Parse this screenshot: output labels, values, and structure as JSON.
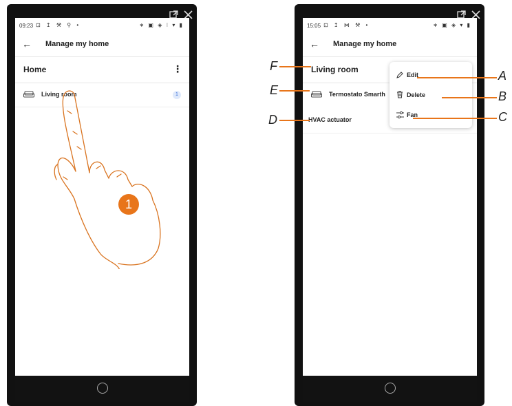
{
  "left_screen": {
    "status_time": "09:23",
    "status_icons_left": "⊡ ↥ ⚒ ⚲ •",
    "status_icons_right": "∗ ▣ ◈ ⁝ ▾ ▮",
    "app_title": "Manage my home",
    "home_header": "Home",
    "more_glyph": "⋮",
    "room_label": "Living room",
    "room_badge": "1",
    "step_number": "1"
  },
  "right_screen": {
    "status_time": "15:05",
    "status_icons_left": "⊡ ↥ ⋈ ⚒ •",
    "status_icons_right": "∗ ▣ ◈ ▾ ▮",
    "app_title": "Manage my home",
    "room_header": "Living room",
    "device_1": "Termostato Smarth",
    "device_2": "HVAC actuator",
    "menu": {
      "edit": "Edit",
      "delete": "Delete",
      "fan": "Fan"
    }
  },
  "annotations": {
    "A": "A",
    "B": "B",
    "C": "C",
    "D": "D",
    "E": "E",
    "F": "F"
  },
  "colors": {
    "accent_orange": "#e8751a",
    "phone_frame": "#111111",
    "badge_bg": "#dfe9fb",
    "badge_text": "#3a6fd8"
  }
}
